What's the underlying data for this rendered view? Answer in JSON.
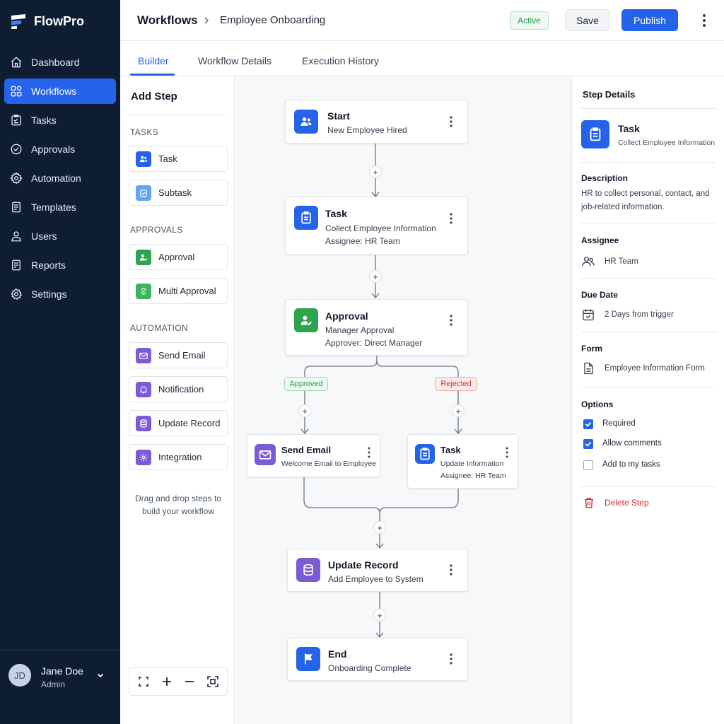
{
  "app": {
    "name": "FlowPro"
  },
  "sidebar": {
    "items": [
      {
        "label": "Dashboard",
        "icon": "home-icon"
      },
      {
        "label": "Workflows",
        "icon": "grid-icon",
        "active": true
      },
      {
        "label": "Tasks",
        "icon": "checklist-icon"
      },
      {
        "label": "Approvals",
        "icon": "check-circle-icon"
      },
      {
        "label": "Automation",
        "icon": "gear-icon"
      },
      {
        "label": "Templates",
        "icon": "document-icon"
      },
      {
        "label": "Users",
        "icon": "user-icon"
      },
      {
        "label": "Reports",
        "icon": "report-icon"
      },
      {
        "label": "Settings",
        "icon": "settings-icon"
      }
    ],
    "user": {
      "initials": "JD",
      "name": "Jane Doe",
      "role": "Admin"
    }
  },
  "header": {
    "breadcrumb_root": "Workflows",
    "breadcrumb_current": "Employee Onboarding",
    "status": "Active",
    "save_label": "Save",
    "publish_label": "Publish"
  },
  "tabs": [
    {
      "label": "Builder",
      "active": true
    },
    {
      "label": "Workflow Details"
    },
    {
      "label": "Execution History"
    }
  ],
  "add_step": {
    "title": "Add Step",
    "groups": [
      {
        "label": "TASKS",
        "items": [
          "Task",
          "Subtask"
        ]
      },
      {
        "label": "APPROVALS",
        "items": [
          "Approval",
          "Multi Approval"
        ]
      },
      {
        "label": "AUTOMATION",
        "items": [
          "Send Email",
          "Notification",
          "Update Record",
          "Integration"
        ]
      }
    ],
    "hint": "Drag and drop steps to build your workflow"
  },
  "canvas": {
    "nodes": {
      "start": {
        "title": "Start",
        "sub1": "New Employee Hired"
      },
      "task": {
        "title": "Task",
        "sub1": "Collect Employee Information",
        "sub2": "Assignee: HR Team"
      },
      "approval": {
        "title": "Approval",
        "sub1": "Manager Approval",
        "sub2": "Approver: Direct Manager"
      },
      "send_email": {
        "title": "Send Email",
        "sub1": "Welcome Email to Employee"
      },
      "task2": {
        "title": "Task",
        "sub1": "Update Information",
        "sub2": "Assignee: HR Team"
      },
      "update_record": {
        "title": "Update Record",
        "sub1": "Add Employee to System"
      },
      "end": {
        "title": "End",
        "sub1": "Onboarding Complete"
      }
    },
    "branch_approved": "Approved",
    "branch_rejected": "Rejected",
    "plus": "+"
  },
  "step_details": {
    "title": "Step Details",
    "step_name": "Task",
    "step_sub": "Collect Employee Information",
    "description_label": "Description",
    "description": "HR to collect personal, contact, and job-related information.",
    "assignee_label": "Assignee",
    "assignee": "HR Team",
    "due_label": "Due Date",
    "due": "2 Days from trigger",
    "form_label": "Form",
    "form": "Employee Information Form",
    "options_label": "Options",
    "options": [
      {
        "label": "Required",
        "checked": true
      },
      {
        "label": "Allow comments",
        "checked": true
      },
      {
        "label": "Add to my tasks",
        "checked": false
      }
    ],
    "delete_label": "Delete Step"
  },
  "colors": {
    "sidebar_bg": "#0f1d33",
    "accent": "#2563eb",
    "success": "#1f9e48",
    "danger": "#dc2626",
    "automation": "#7c5cd6",
    "approval": "#2fa44f"
  }
}
